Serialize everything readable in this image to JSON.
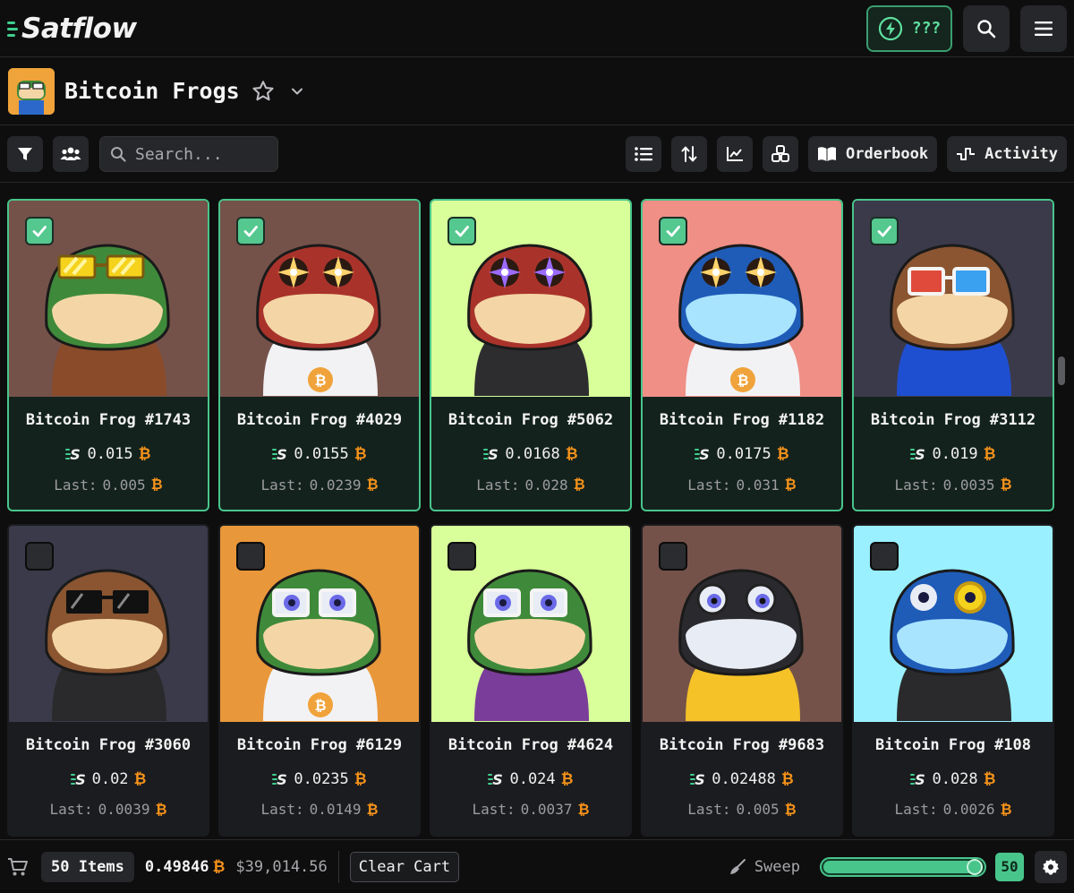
{
  "app": {
    "name": "Satflow",
    "points_label": "???"
  },
  "collection": {
    "name": "Bitcoin Frogs"
  },
  "toolbar": {
    "search_placeholder": "Search...",
    "orderbook_label": "Orderbook",
    "activity_label": "Activity"
  },
  "cards": [
    {
      "name": "Bitcoin Frog #1743",
      "price": "0.015",
      "last": "0.005",
      "selected": true,
      "bg": "#74524a",
      "skin": "#3f8a3a",
      "belly": "#f4d6a6",
      "body": "#8a4b2a",
      "eyes": "#f5d21c",
      "accessory": "yellow-sunglasses"
    },
    {
      "name": "Bitcoin Frog #4029",
      "price": "0.0155",
      "last": "0.0239",
      "selected": true,
      "bg": "#74524a",
      "skin": "#a9332b",
      "belly": "#f4d6a6",
      "body": "#f2f2f5",
      "eyes": "#ffd36b",
      "accessory": "sparkle-eyes"
    },
    {
      "name": "Bitcoin Frog #5062",
      "price": "0.0168",
      "last": "0.028",
      "selected": true,
      "bg": "#d8ff9a",
      "skin": "#a9332b",
      "belly": "#f4d6a6",
      "body": "#2d2d30",
      "eyes": "#9b6bff",
      "accessory": "sparkle-eyes"
    },
    {
      "name": "Bitcoin Frog #1182",
      "price": "0.0175",
      "last": "0.031",
      "selected": true,
      "bg": "#ef8f86",
      "skin": "#1f5cb8",
      "belly": "#a9e4ff",
      "body": "#f2f2f5",
      "eyes": "#ffd36b",
      "accessory": "sparkle-eyes"
    },
    {
      "name": "Bitcoin Frog #3112",
      "price": "0.019",
      "last": "0.0035",
      "selected": true,
      "bg": "#3b3a4a",
      "skin": "#8a5530",
      "belly": "#f4d6a6",
      "body": "#1f4fd1",
      "eyes": "#e04a3a",
      "accessory": "3d-glasses"
    },
    {
      "name": "Bitcoin Frog #3060",
      "price": "0.02",
      "last": "0.0039",
      "selected": false,
      "bg": "#3b3a4a",
      "skin": "#8a5530",
      "belly": "#f4d6a6",
      "body": "#2a2a2c",
      "eyes": "#111111",
      "accessory": "black-sunglasses"
    },
    {
      "name": "Bitcoin Frog #6129",
      "price": "0.0235",
      "last": "0.0149",
      "selected": false,
      "bg": "#e8973a",
      "skin": "#3f8a3a",
      "belly": "#f4d6a6",
      "body": "#f2f2f5",
      "eyes": "#6a6ae8",
      "accessory": "glasses"
    },
    {
      "name": "Bitcoin Frog #4624",
      "price": "0.024",
      "last": "0.0037",
      "selected": false,
      "bg": "#d8ff9a",
      "skin": "#3f8a3a",
      "belly": "#f4d6a6",
      "body": "#7a3d9a",
      "eyes": "#6a6ae8",
      "accessory": "glasses"
    },
    {
      "name": "Bitcoin Frog #9683",
      "price": "0.02488",
      "last": "0.005",
      "selected": false,
      "bg": "#74524a",
      "skin": "#2a2a2e",
      "belly": "#e8ecf5",
      "body": "#f5c227",
      "eyes": "#6a6ae8",
      "accessory": "none"
    },
    {
      "name": "Bitcoin Frog #108",
      "price": "0.028",
      "last": "0.0026",
      "selected": false,
      "bg": "#9af0ff",
      "skin": "#1f5cb8",
      "belly": "#a9e4ff",
      "body": "#2a2a2c",
      "eyes": "#f5d21c",
      "accessory": "monocle"
    }
  ],
  "footer": {
    "items_label": "50 Items",
    "total_btc": "0.49846",
    "total_usd": "$39,014.56",
    "clear_label": "Clear Cart",
    "sweep_label": "Sweep",
    "sweep_count": "50",
    "sweep_fraction": 1.0
  },
  "colors": {
    "accent": "#48c58b",
    "btc": "#f7931a"
  }
}
